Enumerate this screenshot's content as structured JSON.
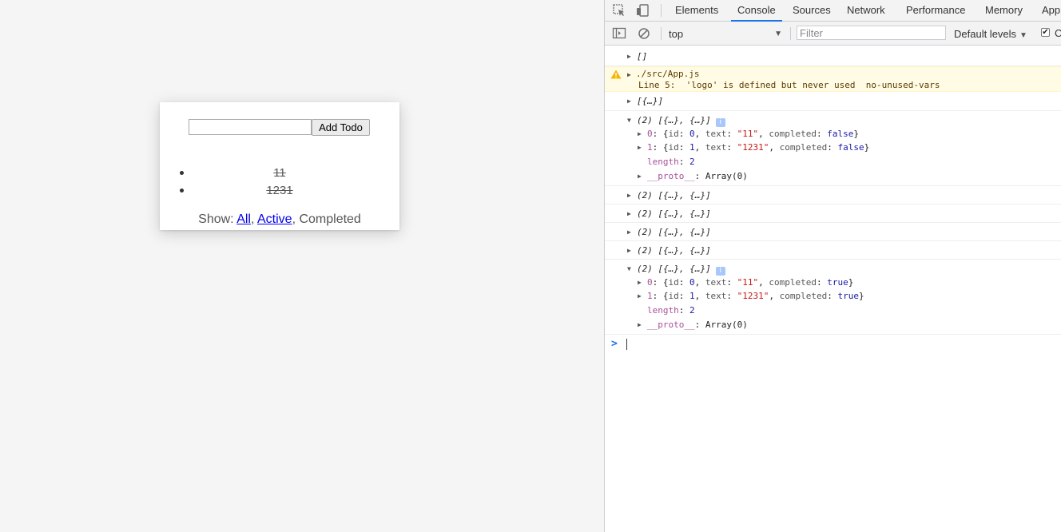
{
  "app": {
    "input_value": "",
    "add_button": "Add Todo",
    "todos": [
      "11",
      "1231"
    ],
    "footer": {
      "show_label": "Show: ",
      "all": "All",
      "sep1": ", ",
      "active": "Active",
      "sep2": ", ",
      "completed": "Completed"
    }
  },
  "devtools": {
    "tabs": [
      "Elements",
      "Console",
      "Sources",
      "Network",
      "Performance",
      "Memory",
      "App"
    ],
    "active_tab": "Console",
    "toolbar": {
      "context": "top",
      "filter_placeholder": "Filter",
      "levels": "Default levels",
      "checkbox_label": "C"
    },
    "console": {
      "empty_array": "[]",
      "warning_file": "./src/App.js",
      "warning_msg": "Line 5:  'logo' is defined but never used  no-unused-vars",
      "single_obj": "[{…}]",
      "expanded_1": {
        "summary": "(2) [{…}, {…}]",
        "items": [
          {
            "idx": "0",
            "id": "0",
            "text": "\"11\"",
            "completed": "false"
          },
          {
            "idx": "1",
            "id": "1",
            "text": "\"1231\"",
            "completed": "false"
          }
        ],
        "length": "2",
        "proto": "Array(0)"
      },
      "collapsed": [
        "(2) [{…}, {…}]",
        "(2) [{…}, {…}]",
        "(2) [{…}, {…}]",
        "(2) [{…}, {…}]"
      ],
      "expanded_2": {
        "summary": "(2) [{…}, {…}]",
        "items": [
          {
            "idx": "0",
            "id": "0",
            "text": "\"11\"",
            "completed": "true"
          },
          {
            "idx": "1",
            "id": "1",
            "text": "\"1231\"",
            "completed": "true"
          }
        ],
        "length": "2",
        "proto": "Array(0)"
      },
      "prompt": ">"
    }
  },
  "colors": {
    "accent": "#1a73e8",
    "warning_bg": "#fffbe5",
    "string": "#c41a16",
    "number": "#1a1aa6",
    "prop": "#a8509a"
  }
}
